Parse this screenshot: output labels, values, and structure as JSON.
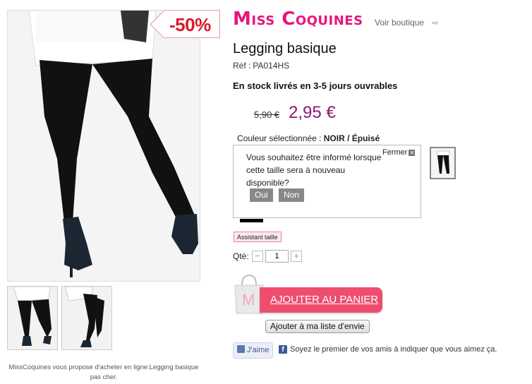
{
  "product": {
    "discount_badge": "-50%",
    "title": "Legging basique",
    "ref_label": "Réf :",
    "ref_value": "PA014HS",
    "stock": "En stock livrés en 3-5 jours ouvrables",
    "old_price": "5,90 €",
    "new_price": "2,95 €",
    "color_label": "Couleur sélectionnée :",
    "color_value": "NOIR / Épuisé"
  },
  "brand": {
    "name": "Miss Coquines",
    "voir_boutique": "Voir boutique",
    "arrow": "⇨"
  },
  "notify": {
    "message": "Vous souhaitez être informé lorsque cette taille sera à nouveau disponible?",
    "close_label": "Fermer",
    "close_icon": "✕",
    "yes": "Oui",
    "no": "Non"
  },
  "size_assistant": "Assistant taille",
  "quantity": {
    "label": "Qté:",
    "value": "1",
    "minus": "−",
    "plus": "+"
  },
  "actions": {
    "add_to_cart": "AJOUTER AU PANIER",
    "wishlist": "Ajouter à ma liste d'envie",
    "bag_letter": "M"
  },
  "facebook": {
    "like": "J'aime",
    "logo": "f",
    "text": "Soyez le premier de vos amis à indiquer que vous aimez ça."
  },
  "seo_text": "MissCoquines vous propose d'acheter en ligne:Legging basique pas cher.",
  "colors": {
    "brand_pink": "#e8157a",
    "price_purple": "#8a1a76",
    "discount_red": "#d81b2a",
    "cart_pink": "#ee4d6e",
    "facebook_blue": "#3b5998"
  }
}
